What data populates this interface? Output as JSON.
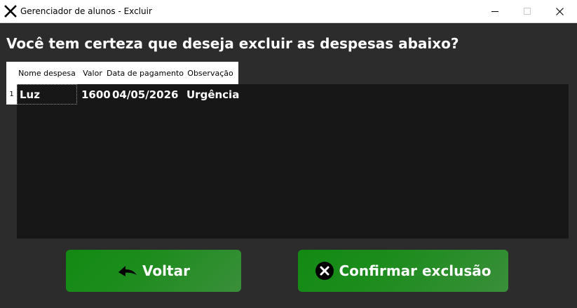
{
  "window": {
    "title": "Gerenciador de alunos - Excluir"
  },
  "heading": "Você tem certeza que deseja excluir as despesas abaixo?",
  "table": {
    "columns": [
      "Nome despesa",
      "Valor",
      "Data de pagamento",
      "Observação"
    ],
    "rows": [
      {
        "index": "1",
        "cells": [
          "Luz",
          "1600",
          "04/05/2026",
          "Urgência"
        ]
      }
    ]
  },
  "buttons": {
    "back_label": "Voltar",
    "back_icon": "back-arrow-icon",
    "confirm_label": "Confirmar exclusão",
    "confirm_icon": "close-circle-icon"
  },
  "colors": {
    "background": "#2c2c2c",
    "table_background": "#171717",
    "button_green": "#1c8c1c",
    "text": "#ffffff"
  }
}
